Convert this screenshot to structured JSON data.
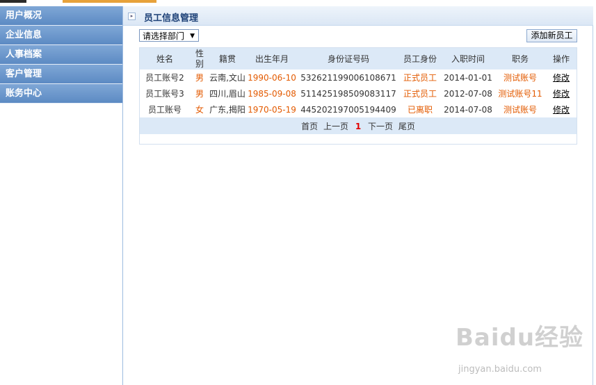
{
  "sidebar": {
    "items": [
      {
        "label": "用户概况"
      },
      {
        "label": "企业信息"
      },
      {
        "label": "人事档案"
      },
      {
        "label": "客户管理"
      },
      {
        "label": "账务中心"
      }
    ]
  },
  "main": {
    "title": "员工信息管理",
    "dept_select": "请选择部门",
    "add_button": "添加新员工"
  },
  "table": {
    "headers": [
      "姓名",
      "性别",
      "籍贯",
      "出生年月",
      "身份证号码",
      "员工身份",
      "入职时间",
      "职务",
      "操作"
    ],
    "rows": [
      {
        "name": "员工账号2",
        "gender": "男",
        "origin": "云南,文山",
        "birth": "1990-06-10",
        "id": "532621199006108671",
        "status": "正式员工",
        "join": "2014-01-01",
        "position": "测试账号",
        "action": "修改"
      },
      {
        "name": "员工账号3",
        "gender": "男",
        "origin": "四川,眉山",
        "birth": "1985-09-08",
        "id": "511425198509083117",
        "status": "正式员工",
        "join": "2012-07-08",
        "position": "测试账号11",
        "action": "修改"
      },
      {
        "name": "员工账号",
        "gender": "女",
        "origin": "广东,揭阳",
        "birth": "1970-05-19",
        "id": "445202197005194409",
        "status": "已离职",
        "join": "2014-07-08",
        "position": "测试账号",
        "action": "修改"
      }
    ]
  },
  "pager": {
    "first": "首页",
    "prev": "上一页",
    "current": "1",
    "next": "下一页",
    "last": "尾页"
  },
  "watermark": {
    "brand": "Baidu经验",
    "url": "jingyan.baidu.com"
  },
  "colors": {
    "sidebar_bg": "#6b97cc",
    "header_bg": "#dce9f7",
    "accent_orange": "#e35a00",
    "current_page_red": "#e10000"
  }
}
